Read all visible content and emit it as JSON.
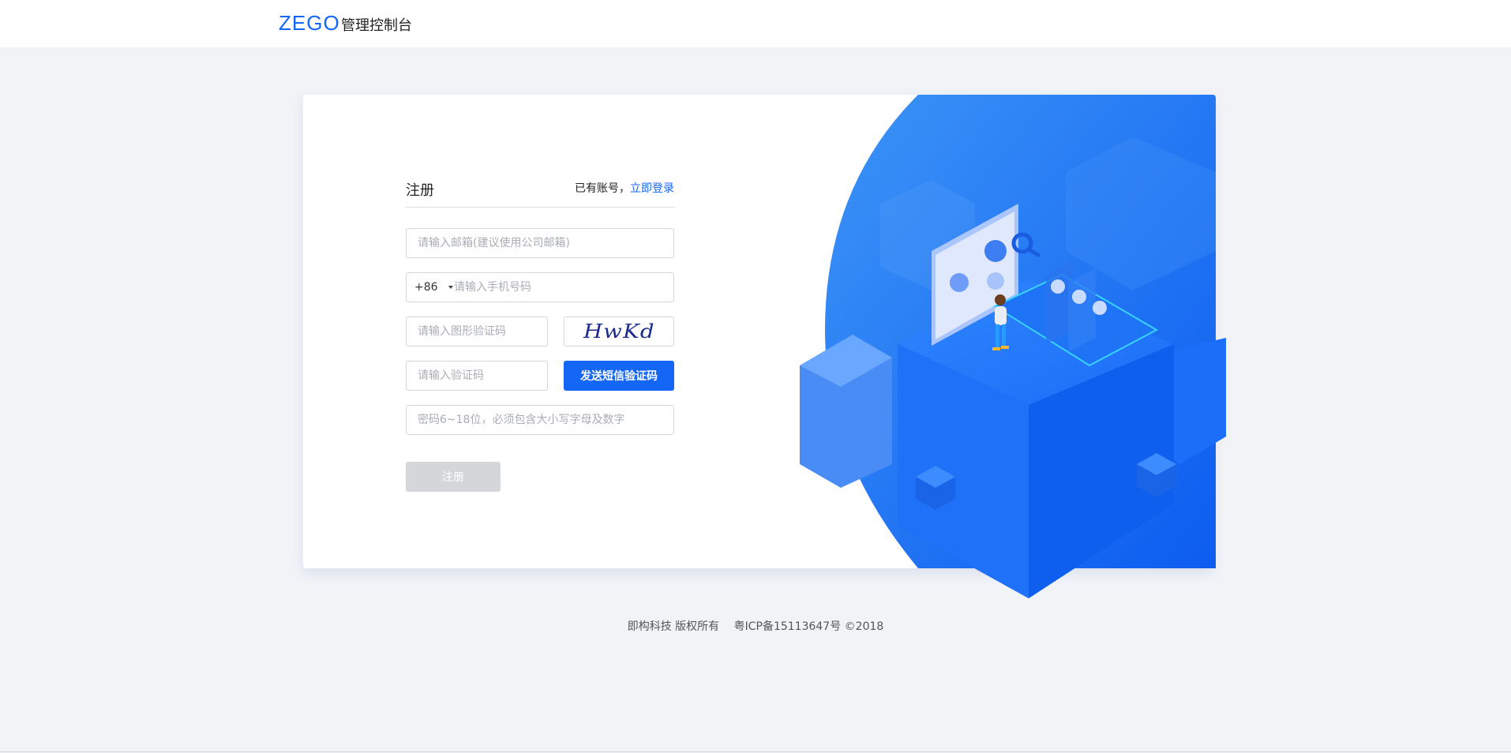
{
  "header": {
    "logo": "ZEGO",
    "title": "管理控制台"
  },
  "form": {
    "title": "注册",
    "login_prompt": "已有账号，",
    "login_link": "立即登录",
    "email_placeholder": "请输入邮箱(建议使用公司邮箱)",
    "country_code": "+86",
    "phone_placeholder": "请输入手机号码",
    "captcha_placeholder": "请输入图形验证码",
    "captcha_text": "HwKd",
    "sms_code_placeholder": "请输入验证码",
    "sms_button": "发送短信验证码",
    "password_placeholder": "密码6~18位，必须包含大小写字母及数字",
    "submit_button": "注册"
  },
  "footer": {
    "company": "即构科技 版权所有",
    "icp": "粤ICP备15113647号 ©2018"
  },
  "colors": {
    "primary": "#1466f5",
    "background": "#f1f3f7",
    "disabled": "#d4d6d9"
  }
}
